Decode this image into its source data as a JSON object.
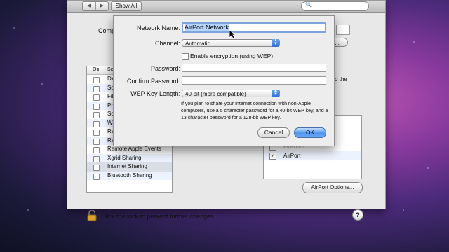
{
  "toolbar": {
    "back": "◀",
    "fwd": "▶",
    "show_all": "Show All",
    "search_icon": "🔍"
  },
  "pref": {
    "computer_name_label": "Compu",
    "edit_label": "t...",
    "services_headers": {
      "on": "On",
      "service": "Se"
    },
    "services": [
      {
        "name": "DV",
        "checked": false,
        "selected": false
      },
      {
        "name": "Scr",
        "checked": false,
        "selected": false
      },
      {
        "name": "File",
        "checked": false,
        "selected": false
      },
      {
        "name": "Prin",
        "checked": false,
        "selected": false
      },
      {
        "name": "Sca",
        "checked": false,
        "selected": false
      },
      {
        "name": "Web",
        "checked": false,
        "selected": false
      },
      {
        "name": "Re",
        "checked": false,
        "selected": false
      },
      {
        "name": "Re",
        "checked": false,
        "selected": false
      },
      {
        "name": "Remote Apple Events",
        "checked": false,
        "selected": false
      },
      {
        "name": "Xgrid Sharing",
        "checked": false,
        "selected": false
      },
      {
        "name": "Internet Sharing",
        "checked": false,
        "selected": true
      },
      {
        "name": "Bluetooth Sharing",
        "checked": false,
        "selected": false
      }
    ],
    "right_info": "o the",
    "ports": [
      {
        "name": "",
        "checked": false
      },
      {
        "name": "",
        "checked": false
      },
      {
        "name": "FireWire",
        "checked": false
      },
      {
        "name": "AirPort",
        "checked": true
      }
    ],
    "airport_options": "AirPort Options...",
    "lock_text": "Click the lock to prevent further changes.",
    "help": "?"
  },
  "sheet": {
    "network_name_label": "Network Name:",
    "network_name_value": "AirPort Network",
    "channel_label": "Channel:",
    "channel_value": "Automatic",
    "encryption_label": "Enable encryption (using WEP)",
    "password_label": "Password:",
    "confirm_label": "Confirm Password:",
    "wep_label": "WEP Key Length:",
    "wep_value": "40-bit (more compatible)",
    "note": "If you plan to share your Internet connection with non-Apple computers, use a 5 character password for a 40-bit WEP key, and a 13 character password for a 128-bit WEP key.",
    "cancel": "Cancel",
    "ok": "OK"
  }
}
